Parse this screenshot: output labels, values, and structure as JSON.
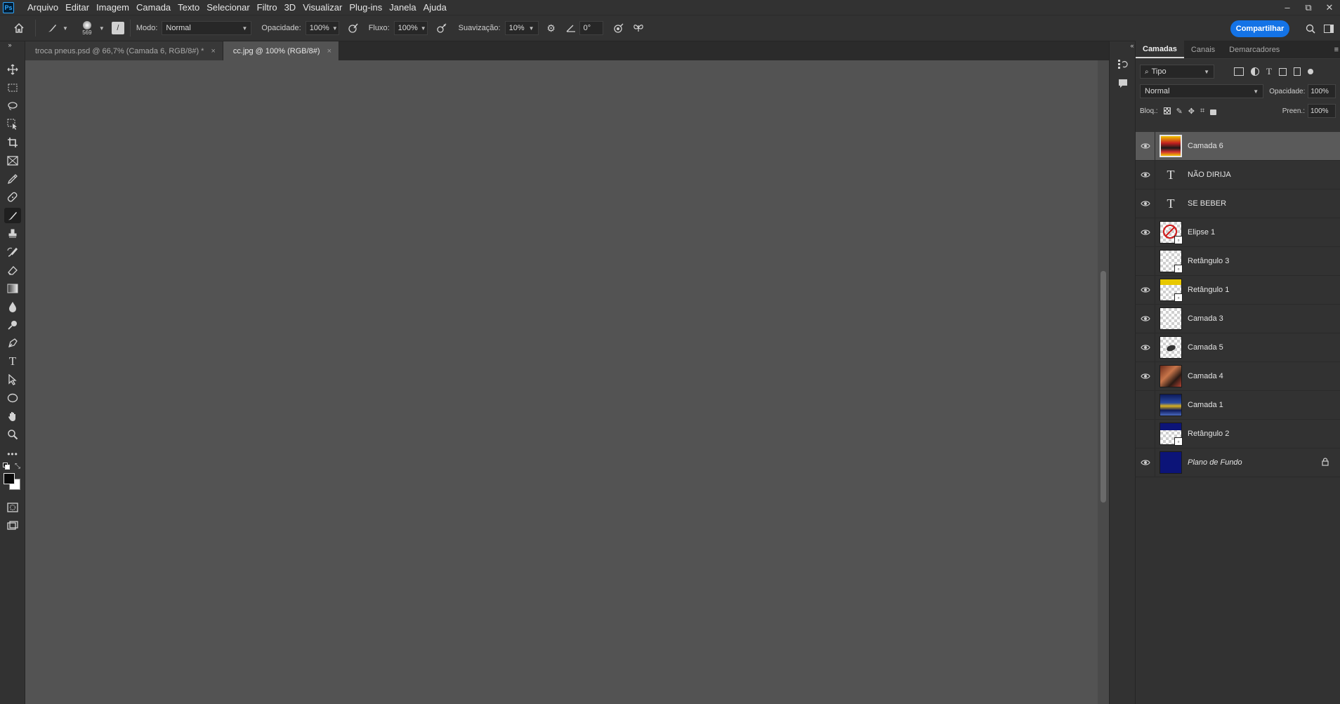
{
  "app": {
    "logo": "Ps"
  },
  "menu": [
    "Arquivo",
    "Editar",
    "Imagem",
    "Camada",
    "Texto",
    "Selecionar",
    "Filtro",
    "3D",
    "Visualizar",
    "Plug-ins",
    "Janela",
    "Ajuda"
  ],
  "window_controls": {
    "minimize": "–",
    "restore": "⧉",
    "close": "✕"
  },
  "options": {
    "brush_size": "569",
    "mode_label": "Modo:",
    "mode_value": "Normal",
    "opacity_label": "Opacidade:",
    "opacity_value": "100%",
    "flow_label": "Fluxo:",
    "flow_value": "100%",
    "smoothing_label": "Suavização:",
    "smoothing_value": "10%",
    "angle_value": "0°",
    "share_label": "Compartilhar"
  },
  "tabs": [
    {
      "label": "troca pneus.psd @ 66,7% (Camada 6, RGB/8#) *",
      "active": false
    },
    {
      "label": "cc.jpg @ 100% (RGB/8#)",
      "active": true
    }
  ],
  "tab_close": "×",
  "panel": {
    "tabs": [
      "Camadas",
      "Canais",
      "Demarcadores"
    ],
    "filter_value": "Tipo",
    "blend_value": "Normal",
    "opacity_label": "Opacidade:",
    "opacity_value": "100%",
    "lock_label": "Bloq.:",
    "fill_label": "Preen.:",
    "fill_value": "100%"
  },
  "layers": [
    {
      "name": "Camada 6",
      "visible": true,
      "selected": true,
      "kind": "image-thumb-poster",
      "italic": false
    },
    {
      "name": "NÃO DIRIJA",
      "visible": true,
      "selected": false,
      "kind": "text",
      "italic": false
    },
    {
      "name": "SE BEBER",
      "visible": true,
      "selected": false,
      "kind": "text",
      "italic": false
    },
    {
      "name": "Elipse 1",
      "visible": true,
      "selected": false,
      "kind": "smart-ellipse",
      "italic": false
    },
    {
      "name": "Retângulo 3",
      "visible": false,
      "selected": false,
      "kind": "smart-checker",
      "italic": false
    },
    {
      "name": "Retângulo 1",
      "visible": true,
      "selected": false,
      "kind": "smart-yellow",
      "italic": false
    },
    {
      "name": "Camada 3",
      "visible": true,
      "selected": false,
      "kind": "checker",
      "italic": false
    },
    {
      "name": "Camada 5",
      "visible": true,
      "selected": false,
      "kind": "checker-blob",
      "italic": false
    },
    {
      "name": "Camada 4",
      "visible": true,
      "selected": false,
      "kind": "image-thumb-person",
      "italic": false
    },
    {
      "name": "Camada 1",
      "visible": false,
      "selected": false,
      "kind": "image-thumb-blue",
      "italic": false
    },
    {
      "name": "Retângulo 2",
      "visible": false,
      "selected": false,
      "kind": "smart-navy",
      "italic": false
    },
    {
      "name": "Plano de Fundo",
      "visible": true,
      "selected": false,
      "kind": "solid-navy",
      "italic": true,
      "locked": true
    }
  ],
  "colors": {
    "accent": "#1473e6",
    "background_layer": "#0c1478"
  }
}
